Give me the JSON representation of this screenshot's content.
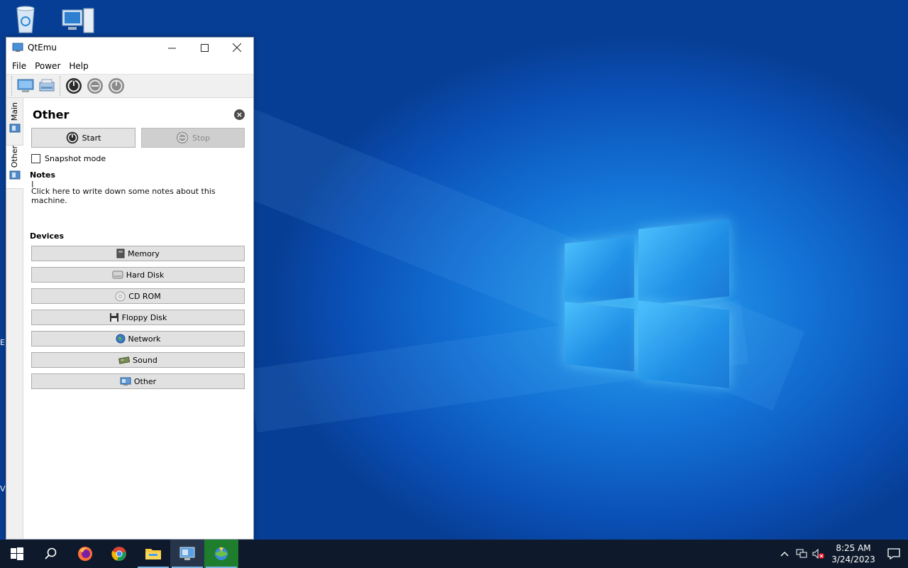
{
  "window": {
    "title": "QtEmu",
    "minimize_glyph": "—",
    "maximize_glyph": "☐",
    "close_glyph": "✕"
  },
  "menu": [
    "File",
    "Power",
    "Help"
  ],
  "side_tabs": [
    {
      "label": "Main",
      "icon": "vm-screen-icon"
    },
    {
      "label": "Other",
      "icon": "vm-screen-icon"
    }
  ],
  "page": {
    "title": "Other",
    "start_label": "Start",
    "stop_label": "Stop",
    "snapshot_label": "Snapshot mode",
    "notes_heading": "Notes",
    "notes_placeholder": "Click here to write down some notes about this machine.",
    "devices_heading": "Devices"
  },
  "devices": [
    {
      "label": "Memory",
      "icon": "memory-icon"
    },
    {
      "label": "Hard Disk",
      "icon": "hard-disk-icon"
    },
    {
      "label": "CD ROM",
      "icon": "cd-rom-icon"
    },
    {
      "label": "Floppy Disk",
      "icon": "floppy-disk-icon"
    },
    {
      "label": "Network",
      "icon": "network-globe-icon"
    },
    {
      "label": "Sound",
      "icon": "sound-card-icon"
    },
    {
      "label": "Other",
      "icon": "other-device-icon"
    }
  ],
  "taskbar": {
    "time": "8:25 AM",
    "date": "3/24/2023",
    "apps": [
      "start-icon",
      "search-icon",
      "firefox-icon",
      "chrome-icon",
      "file-explorer-icon",
      "qtemu-icon",
      "download-manager-icon"
    ]
  },
  "colors": {
    "desktop_blue": "#0b5ec8",
    "taskbar": "#0e1a2b"
  }
}
